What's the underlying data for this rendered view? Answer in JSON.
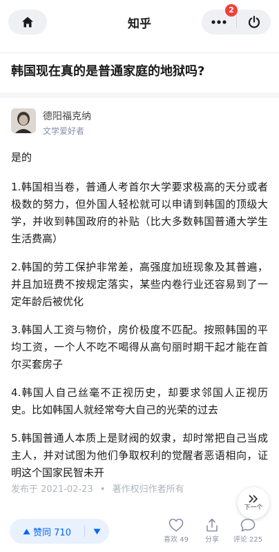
{
  "header": {
    "title": "知乎",
    "notification_count": "2",
    "icons": {
      "home": "home-icon",
      "more": "more-icon",
      "power": "power-icon"
    }
  },
  "question": {
    "title": "韩国现在真的是普通家庭的地狱吗?"
  },
  "author": {
    "name": "德阳福克纳",
    "bio": "文学爱好者"
  },
  "answer": {
    "paragraphs": [
      "是的",
      "1.韩国相当卷，普通人考首尔大学要求极高的天分或者极数的努力，但外国人轻松就可以申请到韩国的顶级大学，并收到韩国政府的补贴（比大多数韩国普通大学生生活费高）",
      "2.韩国的劳工保护非常差，高强度加班现象及其普遍，并且加班费不按规定落实，某些内卷行业还容易到了一定年龄后被优化",
      "3.韩国人工资与物价，房价极度不匹配。按照韩国的平均工资，一个人不吃不喝得从高句丽时期干起才能在首尔买套房子",
      "4.韩国人自己丝毫不正视历史，却要求邻国人正视历史。比如韩国人就经常夸大自己的光荣的过去",
      "5.韩国普通人本质上是财阀的奴隶，却时常把自己当成主人，并对试图为他们争取权利的觉醒者恶语相向，证明这个国家民智未开"
    ],
    "published": "发布于 2021-02-23",
    "separator": "•",
    "copyright": "著作权归作者所有"
  },
  "next_button": {
    "label": "下一个"
  },
  "bottom_bar": {
    "upvote_label": "赞同 710",
    "like_label": "喜欢 49",
    "share_label": "分享",
    "comment_label": "评论 225"
  },
  "colors": {
    "accent": "#0066ff",
    "badge": "#f1403c",
    "muted": "#8590a6"
  }
}
